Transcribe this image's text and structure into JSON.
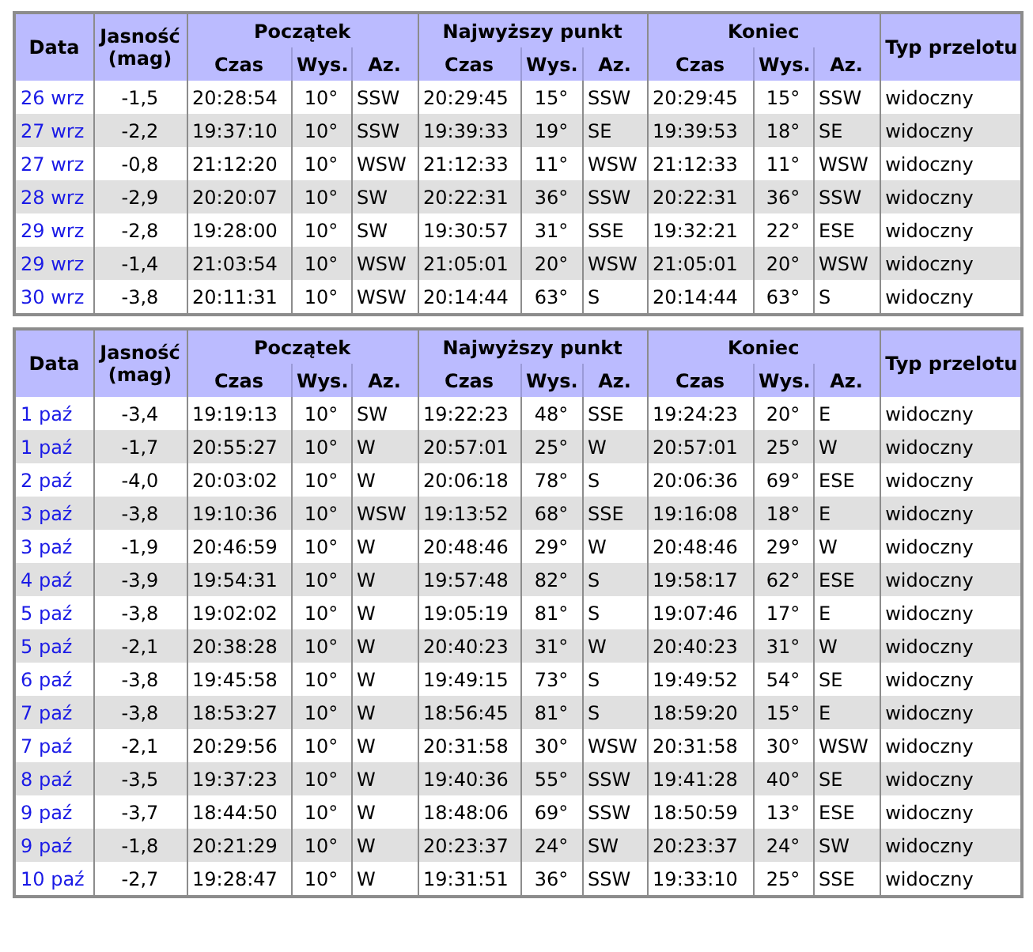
{
  "tables": [
    {
      "header": {
        "date": "Data",
        "brightness": "Jasność",
        "brightness_unit": "(mag)",
        "groups": [
          {
            "title": "Początek",
            "sub": [
              "Czas",
              "Wys.",
              "Az."
            ]
          },
          {
            "title": "Najwyższy punkt",
            "sub": [
              "Czas",
              "Wys.",
              "Az."
            ]
          },
          {
            "title": "Koniec",
            "sub": [
              "Czas",
              "Wys.",
              "Az."
            ]
          }
        ],
        "type": "Typ przelotu"
      },
      "rows": [
        {
          "date": "26 wrz",
          "mag": "-1,5",
          "start": [
            "20:28:54",
            "10°",
            "SSW"
          ],
          "peak": [
            "20:29:45",
            "15°",
            "SSW"
          ],
          "end": [
            "20:29:45",
            "15°",
            "SSW"
          ],
          "type": "widoczny"
        },
        {
          "date": "27 wrz",
          "mag": "-2,2",
          "start": [
            "19:37:10",
            "10°",
            "SSW"
          ],
          "peak": [
            "19:39:33",
            "19°",
            "SE"
          ],
          "end": [
            "19:39:53",
            "18°",
            "SE"
          ],
          "type": "widoczny"
        },
        {
          "date": "27 wrz",
          "mag": "-0,8",
          "start": [
            "21:12:20",
            "10°",
            "WSW"
          ],
          "peak": [
            "21:12:33",
            "11°",
            "WSW"
          ],
          "end": [
            "21:12:33",
            "11°",
            "WSW"
          ],
          "type": "widoczny"
        },
        {
          "date": "28 wrz",
          "mag": "-2,9",
          "start": [
            "20:20:07",
            "10°",
            "SW"
          ],
          "peak": [
            "20:22:31",
            "36°",
            "SSW"
          ],
          "end": [
            "20:22:31",
            "36°",
            "SSW"
          ],
          "type": "widoczny"
        },
        {
          "date": "29 wrz",
          "mag": "-2,8",
          "start": [
            "19:28:00",
            "10°",
            "SW"
          ],
          "peak": [
            "19:30:57",
            "31°",
            "SSE"
          ],
          "end": [
            "19:32:21",
            "22°",
            "ESE"
          ],
          "type": "widoczny"
        },
        {
          "date": "29 wrz",
          "mag": "-1,4",
          "start": [
            "21:03:54",
            "10°",
            "WSW"
          ],
          "peak": [
            "21:05:01",
            "20°",
            "WSW"
          ],
          "end": [
            "21:05:01",
            "20°",
            "WSW"
          ],
          "type": "widoczny"
        },
        {
          "date": "30 wrz",
          "mag": "-3,8",
          "start": [
            "20:11:31",
            "10°",
            "WSW"
          ],
          "peak": [
            "20:14:44",
            "63°",
            "S"
          ],
          "end": [
            "20:14:44",
            "63°",
            "S"
          ],
          "type": "widoczny"
        }
      ]
    },
    {
      "header": {
        "date": "Data",
        "brightness": "Jasność",
        "brightness_unit": "(mag)",
        "groups": [
          {
            "title": "Początek",
            "sub": [
              "Czas",
              "Wys.",
              "Az."
            ]
          },
          {
            "title": "Najwyższy punkt",
            "sub": [
              "Czas",
              "Wys.",
              "Az."
            ]
          },
          {
            "title": "Koniec",
            "sub": [
              "Czas",
              "Wys.",
              "Az."
            ]
          }
        ],
        "type": "Typ przelotu"
      },
      "rows": [
        {
          "date": "1 paź",
          "mag": "-3,4",
          "start": [
            "19:19:13",
            "10°",
            "SW"
          ],
          "peak": [
            "19:22:23",
            "48°",
            "SSE"
          ],
          "end": [
            "19:24:23",
            "20°",
            "E"
          ],
          "type": "widoczny"
        },
        {
          "date": "1 paź",
          "mag": "-1,7",
          "start": [
            "20:55:27",
            "10°",
            "W"
          ],
          "peak": [
            "20:57:01",
            "25°",
            "W"
          ],
          "end": [
            "20:57:01",
            "25°",
            "W"
          ],
          "type": "widoczny"
        },
        {
          "date": "2 paź",
          "mag": "-4,0",
          "start": [
            "20:03:02",
            "10°",
            "W"
          ],
          "peak": [
            "20:06:18",
            "78°",
            "S"
          ],
          "end": [
            "20:06:36",
            "69°",
            "ESE"
          ],
          "type": "widoczny"
        },
        {
          "date": "3 paź",
          "mag": "-3,8",
          "start": [
            "19:10:36",
            "10°",
            "WSW"
          ],
          "peak": [
            "19:13:52",
            "68°",
            "SSE"
          ],
          "end": [
            "19:16:08",
            "18°",
            "E"
          ],
          "type": "widoczny"
        },
        {
          "date": "3 paź",
          "mag": "-1,9",
          "start": [
            "20:46:59",
            "10°",
            "W"
          ],
          "peak": [
            "20:48:46",
            "29°",
            "W"
          ],
          "end": [
            "20:48:46",
            "29°",
            "W"
          ],
          "type": "widoczny"
        },
        {
          "date": "4 paź",
          "mag": "-3,9",
          "start": [
            "19:54:31",
            "10°",
            "W"
          ],
          "peak": [
            "19:57:48",
            "82°",
            "S"
          ],
          "end": [
            "19:58:17",
            "62°",
            "ESE"
          ],
          "type": "widoczny"
        },
        {
          "date": "5 paź",
          "mag": "-3,8",
          "start": [
            "19:02:02",
            "10°",
            "W"
          ],
          "peak": [
            "19:05:19",
            "81°",
            "S"
          ],
          "end": [
            "19:07:46",
            "17°",
            "E"
          ],
          "type": "widoczny"
        },
        {
          "date": "5 paź",
          "mag": "-2,1",
          "start": [
            "20:38:28",
            "10°",
            "W"
          ],
          "peak": [
            "20:40:23",
            "31°",
            "W"
          ],
          "end": [
            "20:40:23",
            "31°",
            "W"
          ],
          "type": "widoczny"
        },
        {
          "date": "6 paź",
          "mag": "-3,8",
          "start": [
            "19:45:58",
            "10°",
            "W"
          ],
          "peak": [
            "19:49:15",
            "73°",
            "S"
          ],
          "end": [
            "19:49:52",
            "54°",
            "SE"
          ],
          "type": "widoczny"
        },
        {
          "date": "7 paź",
          "mag": "-3,8",
          "start": [
            "18:53:27",
            "10°",
            "W"
          ],
          "peak": [
            "18:56:45",
            "81°",
            "S"
          ],
          "end": [
            "18:59:20",
            "15°",
            "E"
          ],
          "type": "widoczny"
        },
        {
          "date": "7 paź",
          "mag": "-2,1",
          "start": [
            "20:29:56",
            "10°",
            "W"
          ],
          "peak": [
            "20:31:58",
            "30°",
            "WSW"
          ],
          "end": [
            "20:31:58",
            "30°",
            "WSW"
          ],
          "type": "widoczny"
        },
        {
          "date": "8 paź",
          "mag": "-3,5",
          "start": [
            "19:37:23",
            "10°",
            "W"
          ],
          "peak": [
            "19:40:36",
            "55°",
            "SSW"
          ],
          "end": [
            "19:41:28",
            "40°",
            "SE"
          ],
          "type": "widoczny"
        },
        {
          "date": "9 paź",
          "mag": "-3,7",
          "start": [
            "18:44:50",
            "10°",
            "W"
          ],
          "peak": [
            "18:48:06",
            "69°",
            "SSW"
          ],
          "end": [
            "18:50:59",
            "13°",
            "ESE"
          ],
          "type": "widoczny"
        },
        {
          "date": "9 paź",
          "mag": "-1,8",
          "start": [
            "20:21:29",
            "10°",
            "W"
          ],
          "peak": [
            "20:23:37",
            "24°",
            "SW"
          ],
          "end": [
            "20:23:37",
            "24°",
            "SW"
          ],
          "type": "widoczny"
        },
        {
          "date": "10 paź",
          "mag": "-2,7",
          "start": [
            "19:28:47",
            "10°",
            "W"
          ],
          "peak": [
            "19:31:51",
            "36°",
            "SSW"
          ],
          "end": [
            "19:33:10",
            "25°",
            "SSE"
          ],
          "type": "widoczny"
        }
      ]
    }
  ]
}
